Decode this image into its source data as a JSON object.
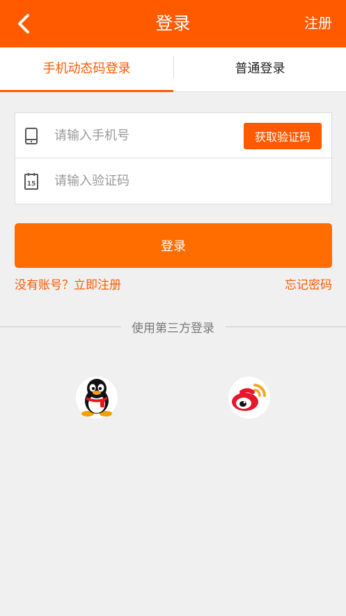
{
  "header": {
    "title": "登录",
    "register_label": "注册"
  },
  "tabs": [
    {
      "label": "手机动态码登录",
      "active": true
    },
    {
      "label": "普通登录",
      "active": false
    }
  ],
  "form": {
    "phone_placeholder": "请输入手机号",
    "get_code_label": "获取验证码",
    "code_placeholder": "请输入验证码",
    "calendar_icon_text": "15"
  },
  "login_button": "登录",
  "links": {
    "register": "没有账号？立即注册",
    "forgot": "忘记密码"
  },
  "third_party": {
    "label": "使用第三方登录",
    "providers": [
      {
        "icon": "qq-icon"
      },
      {
        "icon": "weibo-icon"
      }
    ]
  },
  "colors": {
    "accent": "#ff5a00",
    "button": "#ff6d00",
    "background": "#f0f0f0"
  }
}
